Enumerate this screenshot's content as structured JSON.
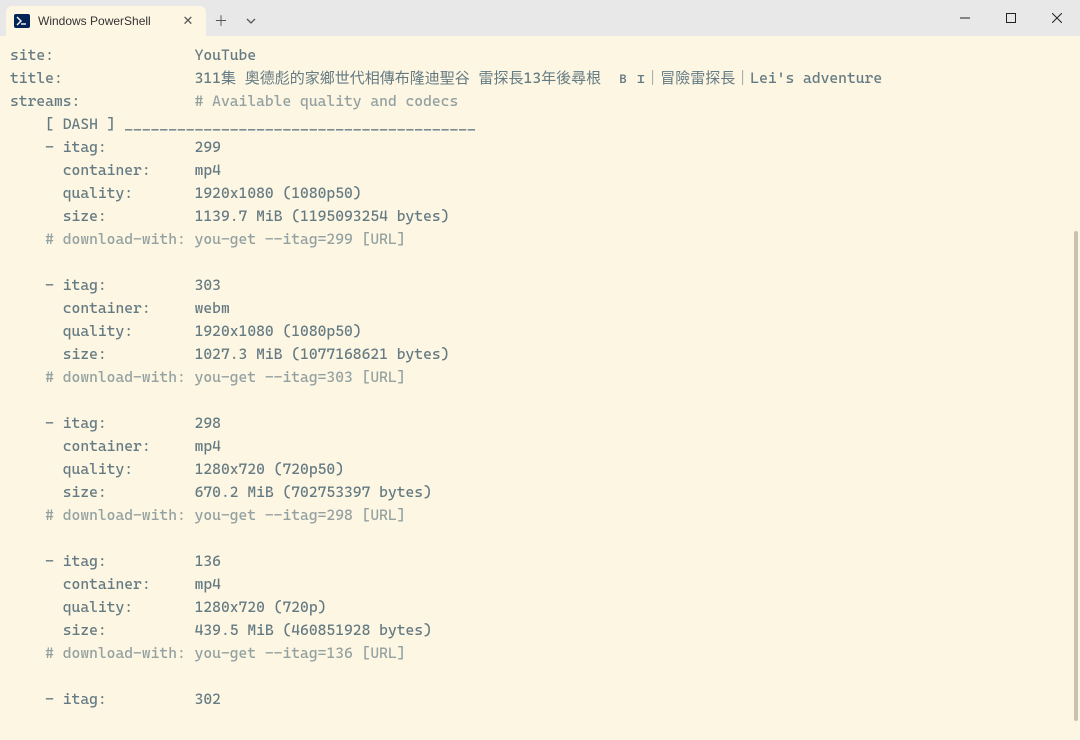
{
  "window": {
    "tab_title": "Windows PowerShell"
  },
  "header": {
    "label_site": "site:",
    "site": "YouTube",
    "label_title": "title:",
    "title": "311集 奧德彪的家鄉世代相傳布隆迪聖谷 雷探長13年後尋根  ʙ ɪ｜冒險雷探長｜Lei's adventure",
    "label_streams": "streams:",
    "streams_comment": "# Available quality and codecs",
    "dash_header": "[ DASH ] ________________________________________"
  },
  "field_labels": {
    "itag": "- itag:",
    "container": "container:",
    "quality": "quality:",
    "size": "size:",
    "download_prefix": "# download-with: you-get --itag=",
    "download_suffix": " [URL]"
  },
  "streams": [
    {
      "itag": "299",
      "container": "mp4",
      "quality": "1920x1080 (1080p50)",
      "size": "1139.7 MiB (1195093254 bytes)"
    },
    {
      "itag": "303",
      "container": "webm",
      "quality": "1920x1080 (1080p50)",
      "size": "1027.3 MiB (1077168621 bytes)"
    },
    {
      "itag": "298",
      "container": "mp4",
      "quality": "1280x720 (720p50)",
      "size": "670.2 MiB (702753397 bytes)"
    },
    {
      "itag": "136",
      "container": "mp4",
      "quality": "1280x720 (720p)",
      "size": "439.5 MiB (460851928 bytes)"
    },
    {
      "itag": "302"
    }
  ]
}
